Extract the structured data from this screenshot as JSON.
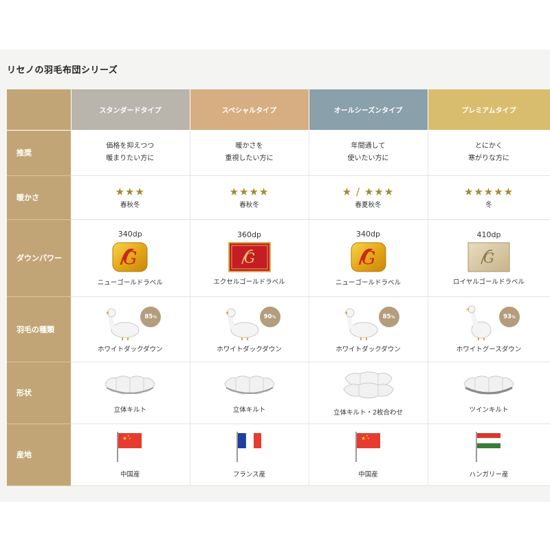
{
  "title": "リセノの羽毛布団シリーズ",
  "columns": [
    {
      "label": "スタンダードタイプ",
      "color": "#b9b5ad"
    },
    {
      "label": "スペシャルタイプ",
      "color": "#d6ae82"
    },
    {
      "label": "オールシーズンタイプ",
      "color": "#8aa0ab"
    },
    {
      "label": "プレミアムタイプ",
      "color": "#d9bd6e"
    }
  ],
  "rows": {
    "recommend": {
      "label": "推奨",
      "cells": [
        {
          "line1": "価格を抑えつつ",
          "line2": "暖まりたい方に"
        },
        {
          "line1": "暖かさを",
          "line2": "重視したい方に"
        },
        {
          "line1": "年間通して",
          "line2": "使いたい方に"
        },
        {
          "line1": "とにかく",
          "line2": "寒がりな方に"
        }
      ]
    },
    "warmth": {
      "label": "暖かさ",
      "cells": [
        {
          "stars": "★★★",
          "seasons": "春秋冬"
        },
        {
          "stars": "★★★★",
          "seasons": "春秋冬"
        },
        {
          "stars": "★ / ★★★",
          "seasons": "春夏秋冬"
        },
        {
          "stars": "★★★★★",
          "seasons": "冬"
        }
      ]
    },
    "downpower": {
      "label": "ダウンパワー",
      "cells": [
        {
          "dp": "340dp",
          "name": "ニューゴールドラベル"
        },
        {
          "dp": "360dp",
          "name": "エクセルゴールドラベル"
        },
        {
          "dp": "340dp",
          "name": "ニューゴールドラベル"
        },
        {
          "dp": "410dp",
          "name": "ロイヤルゴールドラベル"
        }
      ]
    },
    "feather": {
      "label": "羽毛の種類",
      "cells": [
        {
          "percent": "85",
          "unit": "%",
          "name": "ホワイトダックダウン"
        },
        {
          "percent": "90",
          "unit": "%",
          "name": "ホワイトダックダウン"
        },
        {
          "percent": "85",
          "unit": "%",
          "name": "ホワイトダックダウン"
        },
        {
          "percent": "93",
          "unit": "%",
          "name": "ホワイトグースダウン"
        }
      ]
    },
    "shape": {
      "label": "形状",
      "cells": [
        {
          "name": "立体キルト"
        },
        {
          "name": "立体キルト"
        },
        {
          "name": "立体キルト・2枚合わせ"
        },
        {
          "name": "ツインキルト"
        }
      ]
    },
    "origin": {
      "label": "産地",
      "cells": [
        {
          "name": "中国産",
          "flag": "china-flag"
        },
        {
          "name": "フランス産",
          "flag": "france-flag"
        },
        {
          "name": "中国産",
          "flag": "china-flag"
        },
        {
          "name": "ハンガリー産",
          "flag": "hungary-flag"
        }
      ]
    }
  },
  "colors": {
    "row_header": "#c2a576",
    "star": "#a48a2f",
    "badge": "#b39d7c"
  }
}
